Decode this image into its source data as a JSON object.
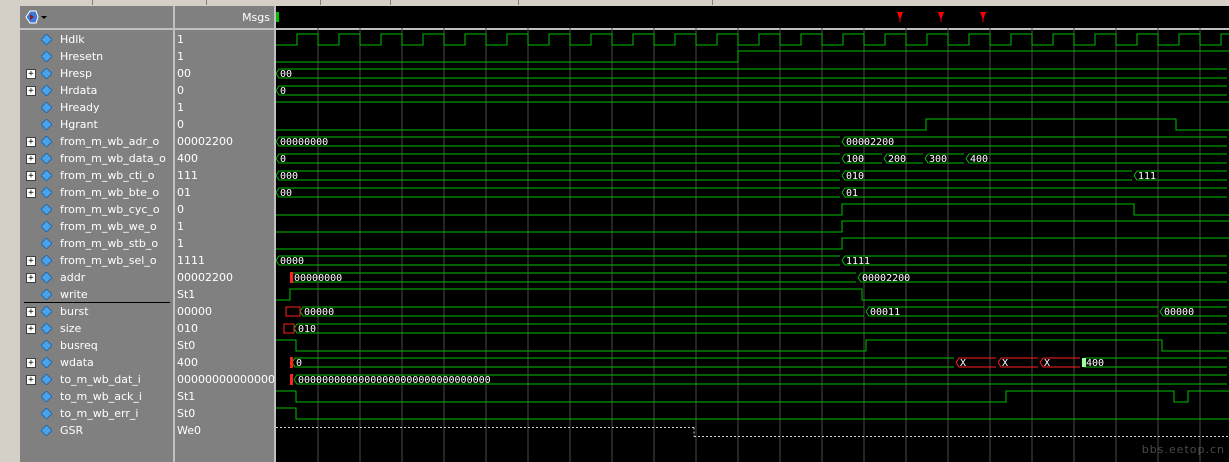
{
  "header": {
    "msgs_label": "Msgs"
  },
  "signals": [
    {
      "name": "Hdlk",
      "value": "1",
      "expand": false
    },
    {
      "name": "Hresetn",
      "value": "1",
      "expand": false
    },
    {
      "name": "Hresp",
      "value": "00",
      "expand": true
    },
    {
      "name": "Hrdata",
      "value": "0",
      "expand": true
    },
    {
      "name": "Hready",
      "value": "1",
      "expand": false
    },
    {
      "name": "Hgrant",
      "value": "0",
      "expand": false
    },
    {
      "name": "from_m_wb_adr_o",
      "value": "00002200",
      "expand": true
    },
    {
      "name": "from_m_wb_data_o",
      "value": "400",
      "expand": true
    },
    {
      "name": "from_m_wb_cti_o",
      "value": "111",
      "expand": true
    },
    {
      "name": "from_m_wb_bte_o",
      "value": "01",
      "expand": true
    },
    {
      "name": "from_m_wb_cyc_o",
      "value": "0",
      "expand": false
    },
    {
      "name": "from_m_wb_we_o",
      "value": "1",
      "expand": false
    },
    {
      "name": "from_m_wb_stb_o",
      "value": "1",
      "expand": false
    },
    {
      "name": "from_m_wb_sel_o",
      "value": "1111",
      "expand": true
    },
    {
      "name": "addr",
      "value": "00002200",
      "expand": true
    },
    {
      "name": "write",
      "value": "St1",
      "expand": false
    },
    {
      "name": "burst",
      "value": "00000",
      "expand": true
    },
    {
      "name": "size",
      "value": "010",
      "expand": true
    },
    {
      "name": "busreq",
      "value": "St0",
      "expand": false
    },
    {
      "name": "wdata",
      "value": "400",
      "expand": true
    },
    {
      "name": "to_m_wb_dat_i",
      "value": "0000000000000000000000000000000",
      "expand": true
    },
    {
      "name": "to_m_wb_ack_i",
      "value": "St1",
      "expand": false
    },
    {
      "name": "to_m_wb_err_i",
      "value": "St0",
      "expand": false
    },
    {
      "name": "GSR",
      "value": "We0",
      "expand": false
    }
  ],
  "wave_labels": {
    "hresp": [
      "00"
    ],
    "hrdata": [
      "0"
    ],
    "adr_o": [
      "00000000",
      "00002200"
    ],
    "data_o": [
      "0",
      "100",
      "200",
      "300",
      "400"
    ],
    "cti_o": [
      "000",
      "010",
      "111"
    ],
    "bte_o": [
      "00",
      "01"
    ],
    "sel_o": [
      "0000",
      "1111"
    ],
    "addr": [
      "00000000",
      "00002200"
    ],
    "burst": [
      "00000",
      "00011",
      "00000"
    ],
    "size": [
      "010"
    ],
    "wdata": [
      "0",
      "X",
      "X",
      "X",
      "400"
    ],
    "dat_i": [
      "00000000000000000000000000000000"
    ]
  },
  "colors": {
    "wave": "#00c000",
    "grid": "#4a4a4a",
    "panel": "#808080",
    "unknown": "#ff2020",
    "cursor": "#ff0000"
  },
  "watermark": "bbs.eetop.cn"
}
